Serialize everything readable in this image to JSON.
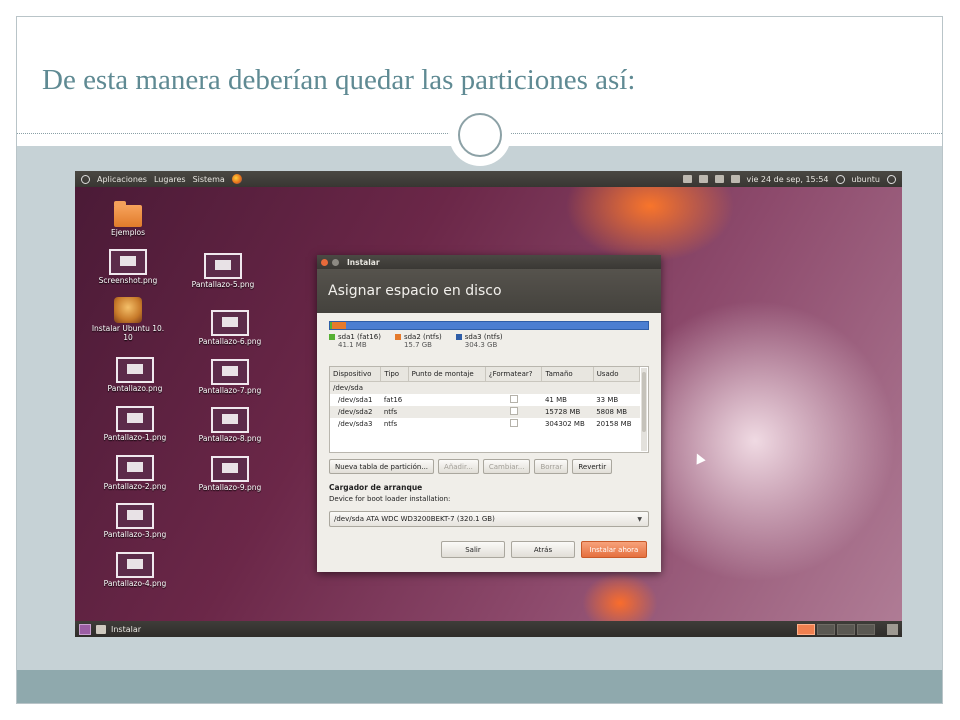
{
  "slide": {
    "title": "De esta manera deberían quedar las particiones  así:"
  },
  "top_panel": {
    "menus": [
      "Aplicaciones",
      "Lugares",
      "Sistema"
    ],
    "datetime": "vie 24 de sep, 15:54",
    "user": "ubuntu"
  },
  "desktop_icons": [
    {
      "label": "Ejemplos",
      "icon": "folder-icon"
    },
    {
      "label": "Screenshot.png",
      "icon": "image-icon"
    },
    {
      "label": "Instalar Ubuntu 10. 10",
      "icon": "installer-icon"
    },
    {
      "label": "Pantallazo.png",
      "icon": "image-icon"
    },
    {
      "label": "Pantallazo-1.png",
      "icon": "image-icon"
    },
    {
      "label": "Pantallazo-2.png",
      "icon": "image-icon"
    },
    {
      "label": "Pantallazo-3.png",
      "icon": "image-icon"
    },
    {
      "label": "Pantallazo-4.png",
      "icon": "image-icon"
    },
    {
      "label": "Pantallazo-5.png",
      "icon": "image-icon"
    },
    {
      "label": "Pantallazo-6.png",
      "icon": "image-icon"
    },
    {
      "label": "Pantallazo-7.png",
      "icon": "image-icon"
    },
    {
      "label": "Pantallazo-8.png",
      "icon": "image-icon"
    },
    {
      "label": "Pantallazo-9.png",
      "icon": "image-icon"
    }
  ],
  "dialog": {
    "window_title": "Instalar",
    "header": "Asignar espacio en disco",
    "legend": [
      {
        "name": "sda1 (fat16)",
        "size": "41.1 MB",
        "color": "#55b033"
      },
      {
        "name": "sda2 (ntfs)",
        "size": "15.7 GB",
        "color": "#e57a2c"
      },
      {
        "name": "sda3 (ntfs)",
        "size": "304.3 GB",
        "color": "#2f5ea8"
      }
    ],
    "table": {
      "headers": [
        "Dispositivo",
        "Tipo",
        "Punto de montaje",
        "¿Formatear?",
        "Tamaño",
        "Usado"
      ],
      "disk": "/dev/sda",
      "rows": [
        {
          "device": "/dev/sda1",
          "type": "fat16",
          "mount": "",
          "size": "41 MB",
          "used": "33 MB"
        },
        {
          "device": "/dev/sda2",
          "type": "ntfs",
          "mount": "",
          "size": "15728 MB",
          "used": "5808 MB"
        },
        {
          "device": "/dev/sda3",
          "type": "ntfs",
          "mount": "",
          "size": "304302 MB",
          "used": "20158 MB"
        }
      ]
    },
    "table_buttons": {
      "new_table": "Nueva tabla de partición...",
      "add": "Añadir...",
      "change": "Cambiar...",
      "delete": "Borrar",
      "revert": "Revertir"
    },
    "bootloader": {
      "title": "Cargador de arranque",
      "subtitle": "Device for boot loader installation:",
      "selected": "/dev/sda ATA WDC WD3200BEKT-7 (320.1 GB)"
    },
    "footer": {
      "quit": "Salir",
      "back": "Atrás",
      "install": "Instalar ahora"
    }
  },
  "bottom_panel": {
    "task": "Instalar"
  }
}
